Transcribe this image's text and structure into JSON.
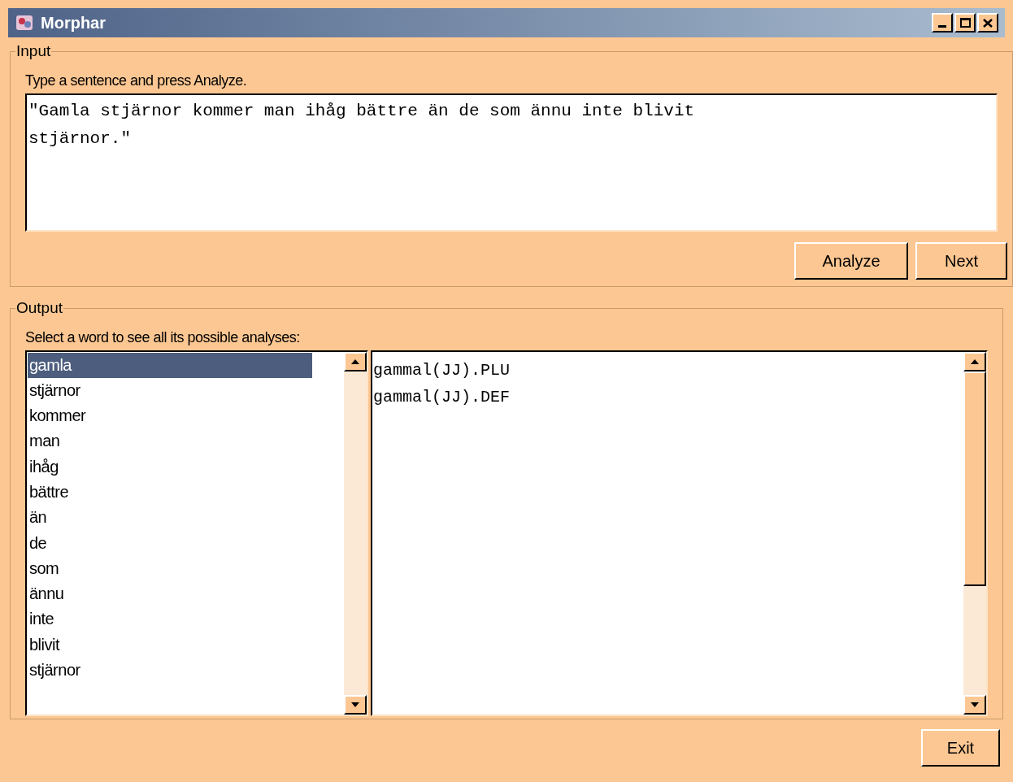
{
  "window": {
    "title": "Morphar"
  },
  "input": {
    "group_label": "Input",
    "prompt": "Type a sentence and press Analyze.",
    "text_lines": [
      "\"Gamla stjärnor kommer man ihåg bättre än de som ännu inte blivit",
      "stjärnor.\""
    ],
    "buttons": [
      "Analyze",
      "Next"
    ]
  },
  "output": {
    "group_label": "Output",
    "prompt": "Select a word to see all its possible analyses:",
    "words": [
      {
        "label": "gamla",
        "selected": true
      },
      {
        "label": "stjärnor",
        "selected": false
      },
      {
        "label": "kommer",
        "selected": false
      },
      {
        "label": "man",
        "selected": false
      },
      {
        "label": "ihåg",
        "selected": false
      },
      {
        "label": "bättre",
        "selected": false
      },
      {
        "label": "än",
        "selected": false
      },
      {
        "label": "de",
        "selected": false
      },
      {
        "label": "som",
        "selected": false
      },
      {
        "label": "ännu",
        "selected": false
      },
      {
        "label": "inte",
        "selected": false
      },
      {
        "label": "blivit",
        "selected": false
      },
      {
        "label": "stjärnor",
        "selected": false
      }
    ],
    "analyses": [
      "gammal(JJ).PLU",
      "gammal(JJ).DEF"
    ]
  },
  "footer_buttons": [
    "Exit"
  ]
}
